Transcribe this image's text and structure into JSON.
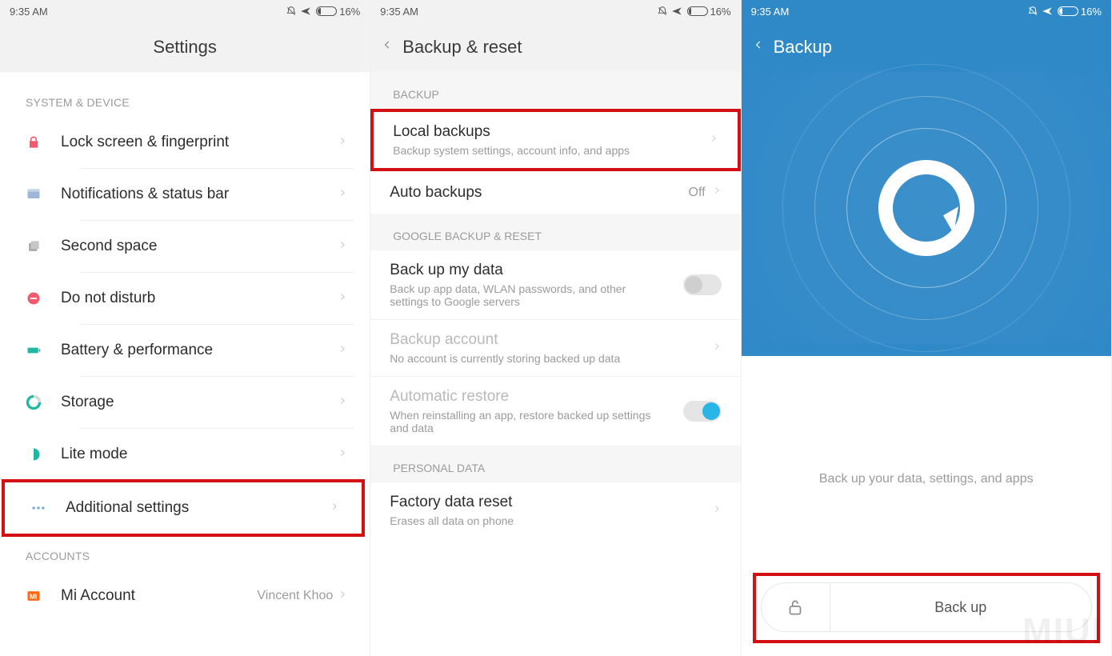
{
  "status": {
    "time": "9:35 AM",
    "battery": "16%"
  },
  "screen1": {
    "title": "Settings",
    "section_system": "SYSTEM & DEVICE",
    "items": [
      {
        "label": "Lock screen & fingerprint"
      },
      {
        "label": "Notifications & status bar"
      },
      {
        "label": "Second space"
      },
      {
        "label": "Do not disturb"
      },
      {
        "label": "Battery & performance"
      },
      {
        "label": "Storage"
      },
      {
        "label": "Lite mode"
      },
      {
        "label": "Additional settings"
      }
    ],
    "section_accounts": "ACCOUNTS",
    "mi_account": {
      "label": "Mi Account",
      "value": "Vincent Khoo"
    }
  },
  "screen2": {
    "title": "Backup & reset",
    "section_backup": "BACKUP",
    "local": {
      "label": "Local backups",
      "sub": "Backup system settings, account info, and apps"
    },
    "auto": {
      "label": "Auto backups",
      "value": "Off"
    },
    "section_google": "GOOGLE BACKUP & RESET",
    "backup_data": {
      "label": "Back up my data",
      "sub": "Back up app data, WLAN passwords, and other settings to Google servers"
    },
    "backup_account": {
      "label": "Backup account",
      "sub": "No account is currently storing backed up data"
    },
    "auto_restore": {
      "label": "Automatic restore",
      "sub": "When reinstalling an app, restore backed up settings and data"
    },
    "section_personal": "PERSONAL DATA",
    "factory": {
      "label": "Factory data reset",
      "sub": "Erases all data on phone"
    }
  },
  "screen3": {
    "title": "Backup",
    "message": "Back up your data, settings, and apps",
    "button": "Back up"
  },
  "watermark": "MIUI"
}
